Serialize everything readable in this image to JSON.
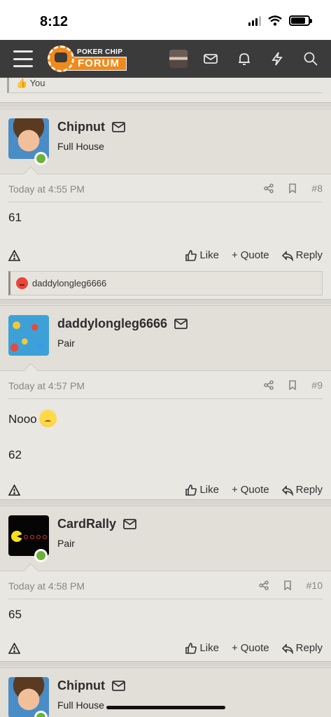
{
  "status_bar": {
    "time": "8:12"
  },
  "nav": {
    "logo_top": "POKER CHIP",
    "logo_bottom": "FORUM"
  },
  "previous_reaction": {
    "text": "You"
  },
  "posts": [
    {
      "username": "Chipnut",
      "rank": "Full House",
      "avatar": "elf-avatar",
      "online": true,
      "date": "Today at 4:55 PM",
      "number": "#8",
      "body": [
        "61"
      ],
      "reactions": "daddylongleg6666"
    },
    {
      "username": "daddylongleg6666",
      "rank": "Pair",
      "avatar": "chips-avatar",
      "online": false,
      "date": "Today at 4:57 PM",
      "number": "#9",
      "body": [
        "Nooo",
        "62"
      ]
    },
    {
      "username": "CardRally",
      "rank": "Pair",
      "avatar": "pacman-avatar",
      "online": true,
      "date": "Today at 4:58 PM",
      "number": "#10",
      "body": [
        "65"
      ]
    },
    {
      "username": "Chipnut",
      "rank": "Full House",
      "avatar": "elf-avatar",
      "online": true
    }
  ],
  "actions": {
    "like": "Like",
    "quote": "Quote",
    "reply": "Reply"
  }
}
